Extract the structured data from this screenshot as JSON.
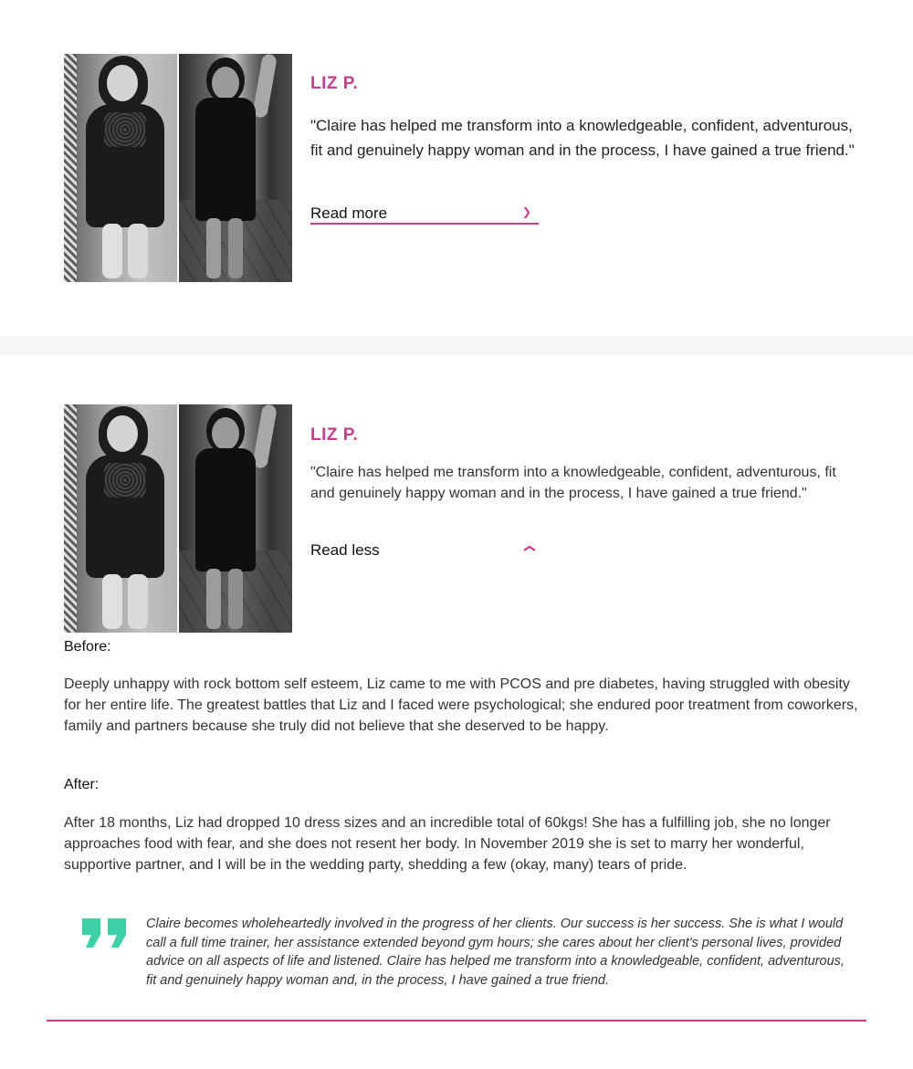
{
  "colors": {
    "accent": "#c63d8c",
    "quote_icon": "#3ecfa6",
    "band": "#f6f6f6"
  },
  "collapsed_card": {
    "name": "LIZ P.",
    "quote": "\"Claire has helped me transform into a knowledgeable, confident, adventurous, fit and genuinely happy woman and in the process, I have gained a true friend.\"",
    "toggle_label": "Read more",
    "toggle_icon": "chevron-down-icon"
  },
  "expanded_card": {
    "name": "LIZ P.",
    "quote": "\"Claire has helped me transform into a knowledgeable, confident, adventurous, fit and genuinely happy woman and in the process, I have gained a true friend.\"",
    "toggle_label": "Read less",
    "toggle_icon": "chevron-up-icon",
    "before_label": "Before:",
    "before_text": "Deeply unhappy with rock bottom self esteem, Liz came to me with PCOS and pre diabetes, having struggled with obesity for her entire life. The greatest battles that Liz and I faced were psychological; she endured poor treatment from coworkers, family and partners because she truly did not believe that she deserved to be happy.",
    "after_label": "After:",
    "after_text": "After 18 months, Liz had dropped 10 dress sizes and an incredible total of 60kgs! She has a fulfilling job, she no longer approaches food with fear, and she does not resent her body. In November 2019 she is set to marry her wonderful, supportive partner, and I will be in the wedding party, shedding a few (okay, many) tears of pride.",
    "testimonial": "Claire becomes wholeheartedly involved in the progress of her clients. Our success is her success. She is what I would call a full time trainer, her assistance extended beyond gym hours; she cares about her client's personal lives, provided advice on all aspects of life and listened. Claire has helped me transform into a knowledgeable, confident, adventurous, fit and genuinely happy woman and, in the process, I have gained a true friend.",
    "quote_icon": "quote-icon"
  }
}
